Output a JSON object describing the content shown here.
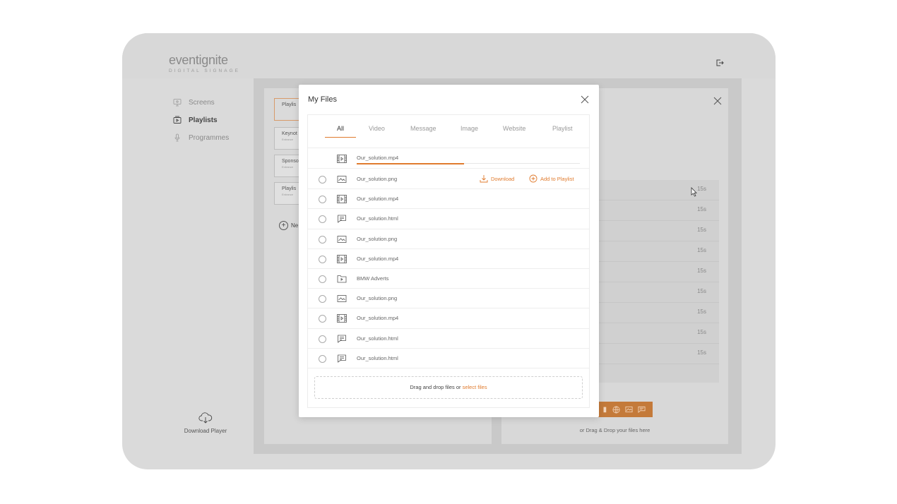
{
  "brand": {
    "logo_text": "eventignite",
    "logo_tagline": "DIGITAL SIGNAGE"
  },
  "colors": {
    "accent": "#e07b2e",
    "frame": "#dadada",
    "overlay": "#c9c9c9"
  },
  "sidebar": {
    "items": [
      {
        "label": "Screens",
        "icon": "monitor-icon",
        "active": false
      },
      {
        "label": "Playlists",
        "icon": "playlist-icon",
        "active": true
      },
      {
        "label": "Programmes",
        "icon": "microphone-icon",
        "active": false
      }
    ],
    "download_label": "Download Player"
  },
  "background_panel": {
    "playlists": [
      {
        "title": "Playlis",
        "sub": ""
      },
      {
        "title": "Keynot",
        "sub": "Entrance"
      },
      {
        "title": "Sponso",
        "sub": "Entrance"
      },
      {
        "title": "Playlis",
        "sub": "Entrance"
      }
    ],
    "new_label": "Ne",
    "durations": [
      "15s",
      "15s",
      "15s",
      "15s",
      "15s",
      "15s",
      "15s",
      "15s",
      "15s"
    ],
    "drop_hint": "or Drag & Drop your files here"
  },
  "modal": {
    "title": "My Files",
    "tabs": [
      "All",
      "Video",
      "Message",
      "Image",
      "Website",
      "Playlist"
    ],
    "active_tab": "All",
    "uploading": {
      "name": "Our_solution.mp4",
      "progress": 0.48,
      "icon": "video-file-icon"
    },
    "files": [
      {
        "name": "Our_solution.png",
        "icon": "image-file-icon"
      },
      {
        "name": "Our_solution.mp4",
        "icon": "video-file-icon"
      },
      {
        "name": "Our_solution.html",
        "icon": "message-file-icon"
      },
      {
        "name": "Our_solution.png",
        "icon": "image-file-icon"
      },
      {
        "name": "Our_solution.mp4",
        "icon": "video-file-icon"
      },
      {
        "name": "BMW Adverts",
        "icon": "playlist-folder-icon"
      },
      {
        "name": "Our_solution.png",
        "icon": "image-file-icon"
      },
      {
        "name": "Our_solution.mp4",
        "icon": "video-file-icon"
      },
      {
        "name": "Our_solution.html",
        "icon": "message-file-icon"
      },
      {
        "name": "Our_solution.html",
        "icon": "message-file-icon"
      }
    ],
    "row_actions": {
      "download": "Download",
      "add": "Add to Playlist"
    },
    "drop": {
      "text": "Drag and drop files or ",
      "link": "select files"
    }
  }
}
